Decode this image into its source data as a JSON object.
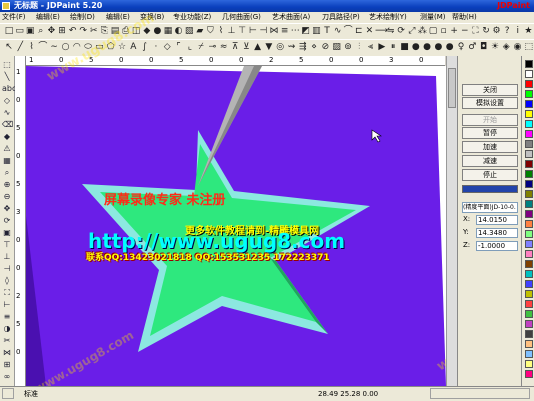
{
  "window": {
    "title": "无标题 - JDPaint 5.20",
    "brand": "JDPaint"
  },
  "menu": [
    {
      "label": "文件(F)"
    },
    {
      "label": "编辑(E)"
    },
    {
      "label": "绘制(D)"
    },
    {
      "label": "编辑(E)"
    },
    {
      "label": "变换(B)"
    },
    {
      "label": "专业功能(Z)"
    },
    {
      "label": "几何曲面(G)"
    },
    {
      "label": "艺术曲面(A)"
    },
    {
      "label": "刀具路径(P)"
    },
    {
      "label": "艺术绘制(Y)"
    },
    {
      "label": "测量(M)"
    },
    {
      "label": "帮助(H)"
    }
  ],
  "toolbar1": [
    {
      "icon": "new-file-icon",
      "glyph": "□"
    },
    {
      "icon": "open-icon",
      "glyph": "▭"
    },
    {
      "icon": "save-icon",
      "glyph": "▣"
    },
    {
      "icon": "zoom-icon",
      "glyph": "⌕"
    },
    {
      "icon": "pan-icon",
      "glyph": "✥"
    },
    {
      "icon": "grid-icon",
      "glyph": "⊞"
    },
    {
      "icon": "undo-icon",
      "glyph": "↶"
    },
    {
      "icon": "redo-icon",
      "glyph": "↷"
    },
    {
      "icon": "cut-icon",
      "glyph": "✂"
    },
    {
      "icon": "copy-icon",
      "glyph": "⎘"
    },
    {
      "icon": "paste-icon",
      "glyph": "▤"
    },
    {
      "icon": "print-icon",
      "glyph": "⎙"
    },
    {
      "icon": "view-icon",
      "glyph": "◫"
    },
    {
      "icon": "surface-icon",
      "glyph": "◆"
    },
    {
      "icon": "sphere-icon",
      "glyph": "●"
    },
    {
      "icon": "mesh-icon",
      "glyph": "▦"
    },
    {
      "icon": "shade-icon",
      "glyph": "◐"
    },
    {
      "icon": "cube-icon",
      "glyph": "▧"
    },
    {
      "icon": "relief-icon",
      "glyph": "▰"
    },
    {
      "icon": "shield-icon",
      "glyph": "⛉"
    },
    {
      "icon": "path-icon",
      "glyph": "⌇"
    },
    {
      "icon": "tool-icon",
      "glyph": "⊥"
    },
    {
      "icon": "drill-icon",
      "glyph": "⊤"
    },
    {
      "icon": "measure-icon",
      "glyph": "⊢"
    },
    {
      "icon": "align-icon",
      "glyph": "⊣"
    },
    {
      "icon": "snap-icon",
      "glyph": "⋈"
    },
    {
      "icon": "layer-icon",
      "glyph": "≡"
    },
    {
      "icon": "node-icon",
      "glyph": "⋯"
    },
    {
      "icon": "fill-icon",
      "glyph": "◩"
    },
    {
      "icon": "hatch-icon",
      "glyph": "▥"
    },
    {
      "icon": "text-icon",
      "glyph": "T"
    },
    {
      "icon": "curve-icon",
      "glyph": "∿"
    },
    {
      "icon": "arc-icon",
      "glyph": "⌒"
    },
    {
      "icon": "offset-icon",
      "glyph": "⊏"
    },
    {
      "icon": "trim-icon",
      "glyph": "✕"
    },
    {
      "icon": "extend-icon",
      "glyph": "⟶"
    },
    {
      "icon": "mirror-icon",
      "glyph": "⇋"
    },
    {
      "icon": "rotate-icon",
      "glyph": "⟳"
    },
    {
      "icon": "scale-icon",
      "glyph": "⤢"
    },
    {
      "icon": "array-icon",
      "glyph": "⁂"
    },
    {
      "icon": "group-icon",
      "glyph": "▢"
    },
    {
      "icon": "ungroup-icon",
      "glyph": "▫"
    },
    {
      "icon": "zoom-in-icon",
      "glyph": "+"
    },
    {
      "icon": "zoom-out-icon",
      "glyph": "−"
    },
    {
      "icon": "fit-icon",
      "glyph": "⛶"
    },
    {
      "icon": "refresh-icon",
      "glyph": "↻"
    },
    {
      "icon": "settings-icon",
      "glyph": "⚙"
    },
    {
      "icon": "help-icon",
      "glyph": "?"
    },
    {
      "icon": "info-icon",
      "glyph": "i"
    },
    {
      "icon": "star-icon",
      "glyph": "★"
    }
  ],
  "toolbar2": [
    {
      "icon": "select-arrow-icon",
      "glyph": "↖"
    },
    {
      "icon": "line-icon",
      "glyph": "╱"
    },
    {
      "icon": "polyline-icon",
      "glyph": "⌇"
    },
    {
      "icon": "arc-draw-icon",
      "glyph": "⌒"
    },
    {
      "icon": "spline-icon",
      "glyph": "∼"
    },
    {
      "icon": "circle-icon",
      "glyph": "○"
    },
    {
      "icon": "arc3-icon",
      "glyph": "◠"
    },
    {
      "icon": "ellipse-icon",
      "glyph": "⬭"
    },
    {
      "icon": "rect-icon",
      "glyph": "▭"
    },
    {
      "icon": "polygon-icon",
      "glyph": "⬠"
    },
    {
      "icon": "star-draw-icon",
      "glyph": "☆"
    },
    {
      "icon": "text-draw-icon",
      "glyph": "A"
    },
    {
      "icon": "bezier-icon",
      "glyph": "∫"
    },
    {
      "icon": "point-icon",
      "glyph": "·"
    },
    {
      "icon": "node-edit-icon",
      "glyph": "◇"
    },
    {
      "icon": "fillet-icon",
      "glyph": "⌜"
    },
    {
      "icon": "chamfer-icon",
      "glyph": "⌞"
    },
    {
      "icon": "break-icon",
      "glyph": "⌿"
    },
    {
      "icon": "join-icon",
      "glyph": "⊸"
    },
    {
      "icon": "smooth-icon",
      "glyph": "≈"
    },
    {
      "icon": "project-icon",
      "glyph": "⊼"
    },
    {
      "icon": "wrap-icon",
      "glyph": "⊻"
    },
    {
      "icon": "emboss-icon",
      "glyph": "▲"
    },
    {
      "icon": "engrave-icon",
      "glyph": "▼"
    },
    {
      "icon": "lathe-icon",
      "glyph": "◎"
    },
    {
      "icon": "sweep-icon",
      "glyph": "⇝"
    },
    {
      "icon": "loft-icon",
      "glyph": "⇶"
    },
    {
      "icon": "blend-icon",
      "glyph": "⋄"
    },
    {
      "icon": "trim-surface-icon",
      "glyph": "⊘"
    },
    {
      "icon": "patch-icon",
      "glyph": "▨"
    },
    {
      "icon": "shell-icon",
      "glyph": "⊚"
    },
    {
      "icon": "split-icon",
      "glyph": "⫶"
    },
    {
      "icon": "merge-icon",
      "glyph": "⫷"
    },
    {
      "icon": "sim-icon",
      "glyph": "▶"
    },
    {
      "icon": "pause-sim-icon",
      "glyph": "⏸"
    },
    {
      "icon": "stop-sim-icon",
      "glyph": "■"
    },
    {
      "icon": "color-red-icon",
      "glyph": "●"
    },
    {
      "icon": "color-green-icon",
      "glyph": "●"
    },
    {
      "icon": "color-blue-icon",
      "glyph": "●"
    },
    {
      "icon": "color-yellow-icon",
      "glyph": "●"
    },
    {
      "icon": "bulb-icon",
      "glyph": "♀"
    },
    {
      "icon": "lamp-icon",
      "glyph": "♂"
    },
    {
      "icon": "camera-icon",
      "glyph": "◘"
    },
    {
      "icon": "light-icon",
      "glyph": "☀"
    },
    {
      "icon": "material-icon",
      "glyph": "◈"
    },
    {
      "icon": "render-icon",
      "glyph": "◉"
    },
    {
      "icon": "wire-icon",
      "glyph": "⬚"
    }
  ],
  "lefttools": [
    {
      "icon": "select-icon",
      "glyph": "⬚"
    },
    {
      "icon": "line-tool-icon",
      "glyph": "╲"
    },
    {
      "icon": "abc-text-icon",
      "glyph": "abc"
    },
    {
      "icon": "node-tool-icon",
      "glyph": "◇"
    },
    {
      "icon": "curve-tool-icon",
      "glyph": "∿"
    },
    {
      "icon": "erase-icon",
      "glyph": "⌫"
    },
    {
      "icon": "fill-tool-icon",
      "glyph": "◆"
    },
    {
      "icon": "warn-icon",
      "glyph": "⚠"
    },
    {
      "icon": "map-icon",
      "glyph": "▦"
    },
    {
      "icon": "zoom-tool-icon",
      "glyph": "⌕"
    },
    {
      "icon": "zoom-in-tool-icon",
      "glyph": "⊕"
    },
    {
      "icon": "zoom-out-tool-icon",
      "glyph": "⊖"
    },
    {
      "icon": "pan-tool-icon",
      "glyph": "✥"
    },
    {
      "icon": "rotate-tool-icon",
      "glyph": "⟳"
    },
    {
      "icon": "view3d-icon",
      "glyph": "▣"
    },
    {
      "icon": "top-view-icon",
      "glyph": "⊤"
    },
    {
      "icon": "front-view-icon",
      "glyph": "⊥"
    },
    {
      "icon": "side-view-icon",
      "glyph": "⊣"
    },
    {
      "icon": "iso-view-icon",
      "glyph": "◊"
    },
    {
      "icon": "fit-tool-icon",
      "glyph": "⛶"
    },
    {
      "icon": "measure-tool-icon",
      "glyph": "⊢"
    },
    {
      "icon": "layer-tool-icon",
      "glyph": "≡"
    },
    {
      "icon": "color-tool-icon",
      "glyph": "◑"
    },
    {
      "icon": "clip-icon",
      "glyph": "✂"
    },
    {
      "icon": "snap-tool-icon",
      "glyph": "⋈"
    },
    {
      "icon": "grid-tool-icon",
      "glyph": "⊞"
    },
    {
      "icon": "link-icon",
      "glyph": "∞"
    }
  ],
  "vruler": [
    "1",
    "0",
    "5",
    "0",
    "5",
    "3",
    "0",
    "0",
    "2",
    "5",
    "0"
  ],
  "hruler": [
    "1",
    "0",
    "5",
    "0",
    "0",
    "5",
    "0",
    "0",
    "2",
    "5",
    "0",
    "0",
    "3",
    "0"
  ],
  "panel": {
    "close": "关闭",
    "sim_settings": "模拟设置",
    "start": "开始",
    "pause": "暂停",
    "speed_up": "加速",
    "slow_down": "减速",
    "stop": "停止",
    "plane": "(精度平面)JD-10-0.",
    "x_label": "X:",
    "x_value": "14.0150",
    "y_label": "Y:",
    "y_value": "14.3480",
    "z_label": "Z:",
    "z_value": "-1.0000"
  },
  "palette": [
    "#000000",
    "#ffffff",
    "#ff0000",
    "#00ff00",
    "#0000ff",
    "#ffff00",
    "#00ffff",
    "#ff00ff",
    "#808080",
    "#c0c0c0",
    "#800000",
    "#008000",
    "#000080",
    "#808000",
    "#008080",
    "#800080",
    "#ff8040",
    "#80ff80",
    "#8080ff",
    "#ff80c0",
    "#804000",
    "#00c0c0",
    "#4040ff",
    "#c0c000",
    "#ff4040",
    "#40c040",
    "#c040c0",
    "#404040",
    "#ffc080",
    "#80c0ff",
    "#ffff80",
    "#ff0080"
  ],
  "status": {
    "coords": "28.49 25.28 0.00",
    "mode": "标准"
  },
  "scene": {
    "background": "#6a1ee8",
    "star_color": "#2ee87e",
    "star_edge": "#8ce8e0",
    "tool_color": "#b4b4b4"
  },
  "overlay": {
    "line1": "屏幕录像专家 未注册",
    "line2": "更多软件教程请到-精雕模具网",
    "line3": "http://www.ugug8.com",
    "line4": "联系QQ:13423021818 QQ:153531235 172223371",
    "wm": "www.ugug8.com"
  }
}
